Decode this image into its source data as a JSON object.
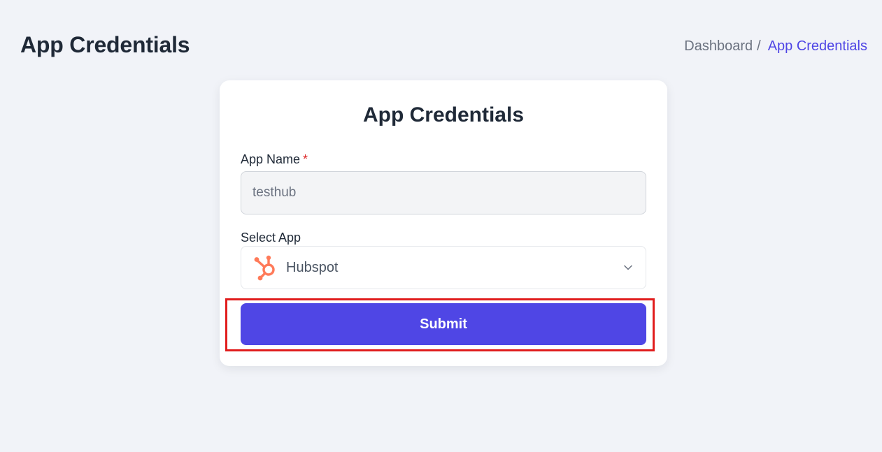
{
  "header": {
    "title": "App Credentials",
    "breadcrumb": {
      "home": "Dashboard",
      "separator": "/",
      "current": "App Credentials"
    }
  },
  "form": {
    "title": "App Credentials",
    "app_name": {
      "label": "App Name",
      "required_mark": "*",
      "value": "testhub"
    },
    "select_app": {
      "label": "Select App",
      "selected": "Hubspot",
      "icon": "hubspot-logo-icon"
    },
    "submit_label": "Submit"
  },
  "colors": {
    "accent": "#4f46e5",
    "page_bg": "#f1f3f8",
    "hubspot": "#ff7a59",
    "highlight": "#e11d1d"
  }
}
